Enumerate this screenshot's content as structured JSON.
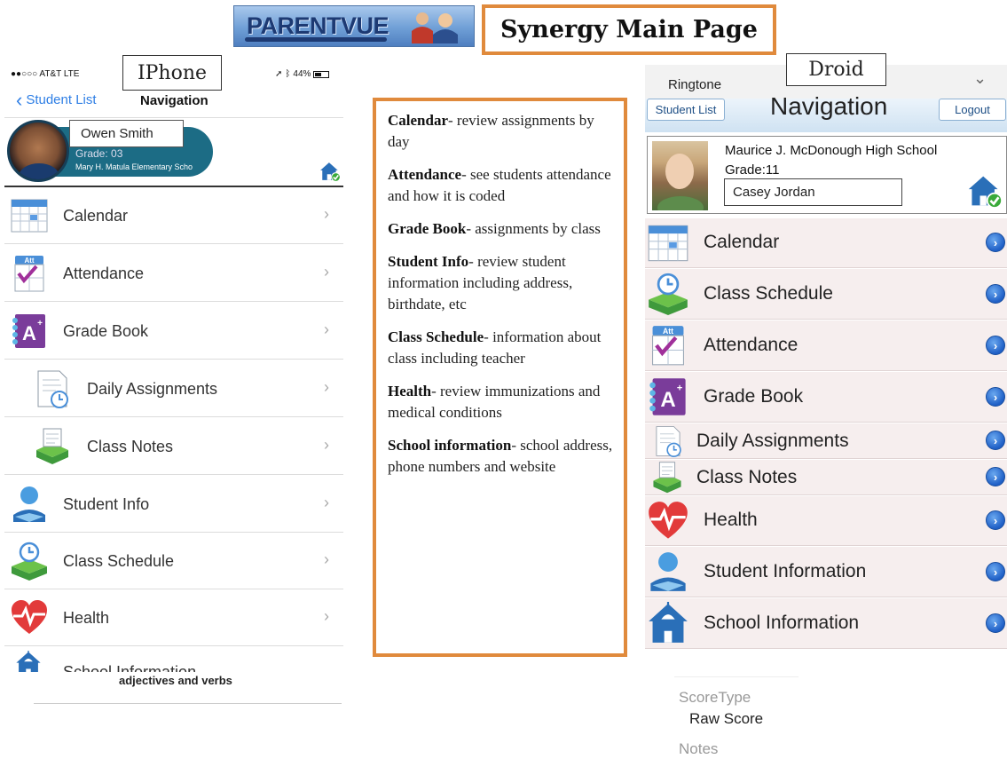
{
  "header": {
    "logo_text": "PARENTVUE",
    "main_title": "Synergy Main Page"
  },
  "iphone": {
    "device_label": "IPhone",
    "status_left": "●●○○○ AT&T  LTE",
    "status_right": "44%",
    "back_label": "Student List",
    "nav_title": "Navigation",
    "student": {
      "name": "Owen Smith",
      "grade": "Grade: 03",
      "school": "Mary H. Matula Elementary Scho"
    },
    "menu": [
      {
        "label": "Calendar",
        "icon": "calendar-icon"
      },
      {
        "label": "Attendance",
        "icon": "attendance-icon"
      },
      {
        "label": "Grade Book",
        "icon": "gradebook-icon"
      },
      {
        "label": "Daily Assignments",
        "icon": "assignment-icon"
      },
      {
        "label": "Class Notes",
        "icon": "class-notes-icon"
      },
      {
        "label": "Student Info",
        "icon": "student-icon"
      },
      {
        "label": "Class Schedule",
        "icon": "schedule-icon"
      },
      {
        "label": "Health",
        "icon": "heart-icon"
      }
    ],
    "partial_row": "School Information",
    "footer_text": "adjectives and verbs"
  },
  "descriptions": [
    {
      "term": "Calendar",
      "text": "- review assignments by day"
    },
    {
      "term": "Attendance",
      "text": "- see students attendance and how it is coded"
    },
    {
      "term": "Grade Book",
      "text": "- assignments by class"
    },
    {
      "term": "Student Info",
      "text": "- review student information including address, birthdate, etc"
    },
    {
      "term": "Class Schedule",
      "text": "- information about class including teacher"
    },
    {
      "term": "Health",
      "text": "- review immunizations and medical conditions"
    },
    {
      "term": "School information",
      "text": "- school address, phone numbers and website"
    }
  ],
  "droid": {
    "device_label": "Droid",
    "ringtone": "Ringtone",
    "student_list_button": "Student List",
    "nav_title": "Navigation",
    "logout_button": "Logout",
    "student": {
      "school": "Maurice J. McDonough High School",
      "grade": "Grade:11",
      "name": "Casey Jordan"
    },
    "menu": [
      {
        "label": "Calendar",
        "icon": "calendar-icon"
      },
      {
        "label": "Class Schedule",
        "icon": "schedule-icon"
      },
      {
        "label": "Attendance",
        "icon": "attendance-icon"
      },
      {
        "label": "Grade Book",
        "icon": "gradebook-icon"
      },
      {
        "label": "Daily Assignments",
        "icon": "assignment-icon"
      },
      {
        "label": "Class Notes",
        "icon": "class-notes-icon"
      },
      {
        "label": "Health",
        "icon": "heart-icon"
      },
      {
        "label": "Student Information",
        "icon": "student-icon"
      },
      {
        "label": "School Information",
        "icon": "school-icon"
      }
    ],
    "score_type_label": "ScoreType",
    "score_type_value": "Raw Score",
    "notes_label": "Notes"
  },
  "colors": {
    "accent_orange": "#e08a3c",
    "ios_blue": "#2f7fe5",
    "student_pill": "#1c6c85",
    "droid_arrow": "#1f5fc6"
  }
}
